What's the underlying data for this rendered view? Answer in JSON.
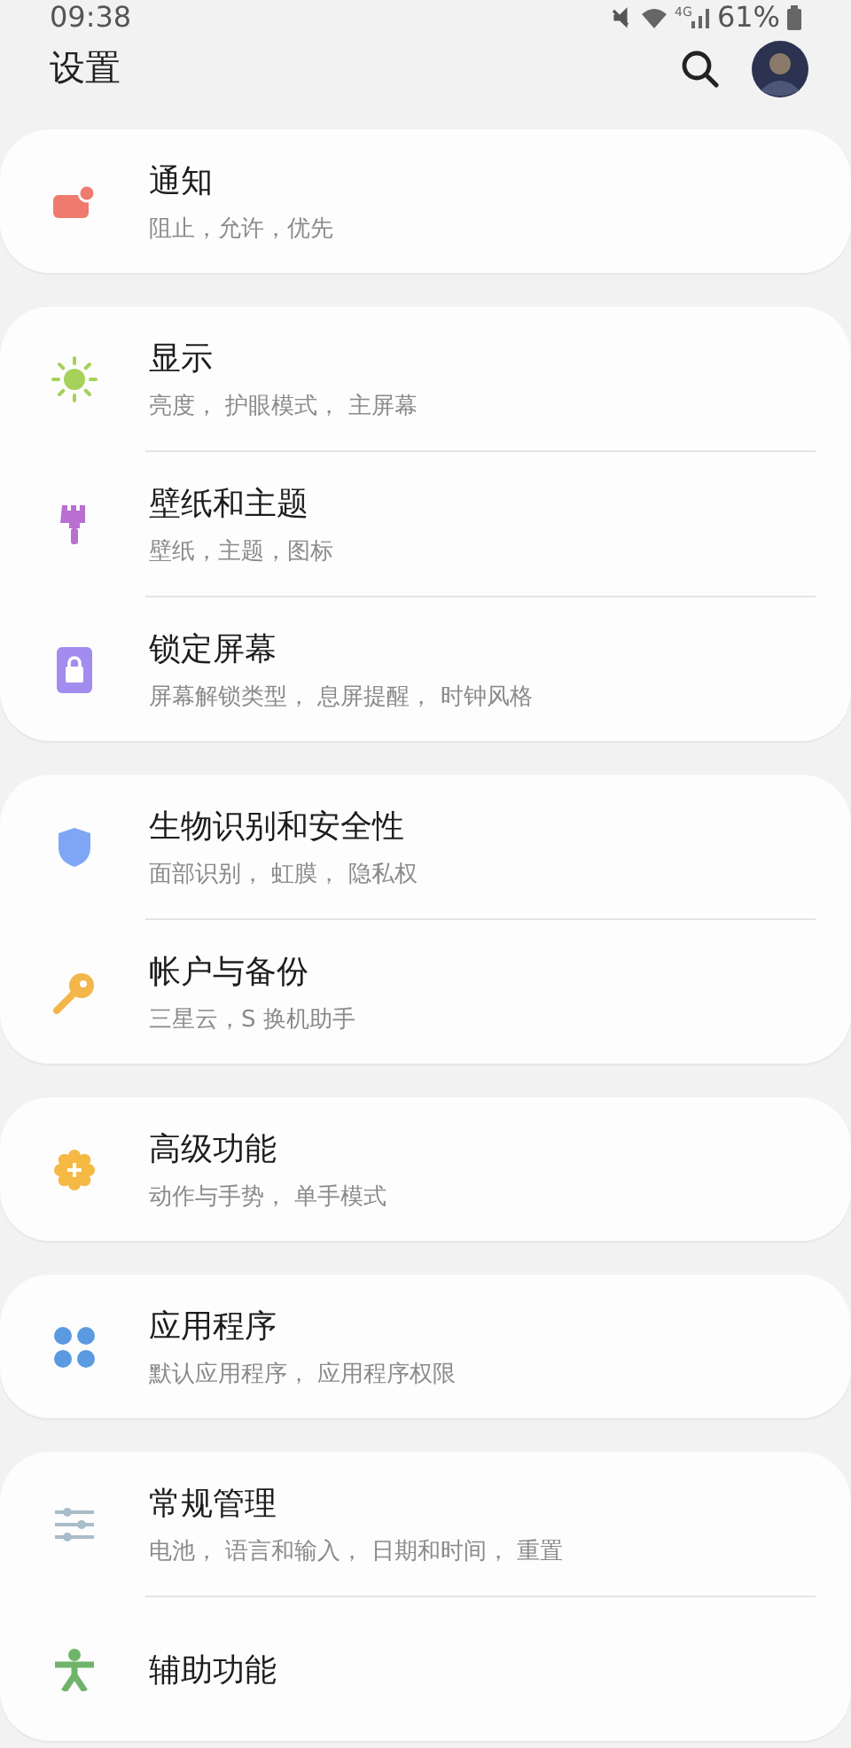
{
  "status_bar": {
    "time": "09:38",
    "network": "4G",
    "battery": "61%"
  },
  "header": {
    "title": "设置"
  },
  "groups": [
    {
      "items": [
        {
          "kind": "notify",
          "color": "#ee7b6e",
          "title": "通知",
          "subtitle": "阻止，允许，优先"
        }
      ]
    },
    {
      "items": [
        {
          "kind": "sun",
          "color": "#a6d15a",
          "title": "显示",
          "subtitle": "亮度， 护眼模式， 主屏幕"
        },
        {
          "kind": "brush",
          "color": "#b96fd0",
          "title": "壁纸和主题",
          "subtitle": "壁纸，主题，图标"
        },
        {
          "kind": "lock",
          "color": "#a38cf0",
          "title": "锁定屏幕",
          "subtitle": "屏幕解锁类型， 息屏提醒， 时钟风格"
        }
      ]
    },
    {
      "items": [
        {
          "kind": "shield",
          "color": "#7fa6f5",
          "title": "生物识别和安全性",
          "subtitle": "面部识别， 虹膜， 隐私权"
        },
        {
          "kind": "key",
          "color": "#f3b64a",
          "title": "帐户与备份",
          "subtitle": "三星云，S 换机助手"
        }
      ]
    },
    {
      "items": [
        {
          "kind": "gear",
          "color": "#f5b944",
          "title": "高级功能",
          "subtitle": "动作与手势， 单手模式"
        }
      ]
    },
    {
      "items": [
        {
          "kind": "dots",
          "color": "#5b9ae0",
          "title": "应用程序",
          "subtitle": "默认应用程序， 应用程序权限"
        }
      ]
    },
    {
      "items": [
        {
          "kind": "sliders",
          "color": "#a9bcc9",
          "title": "常规管理",
          "subtitle": "电池， 语言和输入， 日期和时间， 重置"
        },
        {
          "kind": "person",
          "color": "#6fb46a",
          "title": "辅助功能"
        }
      ]
    }
  ]
}
